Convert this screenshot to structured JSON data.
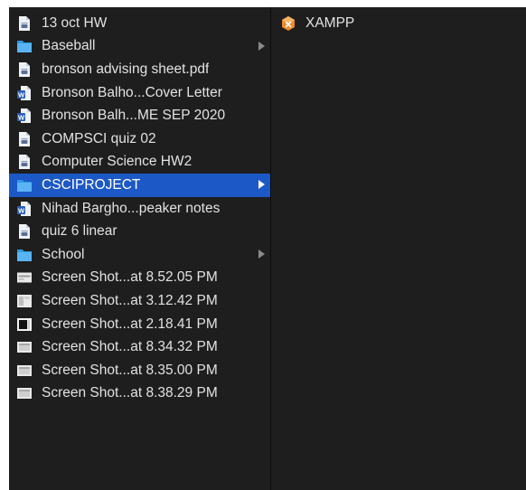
{
  "left_column": {
    "items": [
      {
        "label": "13 oct HW",
        "icon": "document-icon",
        "chevron": false,
        "selected": false
      },
      {
        "label": "Baseball",
        "icon": "folder-icon",
        "chevron": true,
        "selected": false
      },
      {
        "label": "bronson advising sheet.pdf",
        "icon": "document-icon",
        "chevron": false,
        "selected": false
      },
      {
        "label": "Bronson Balho...Cover Letter",
        "icon": "word-document-icon",
        "chevron": false,
        "selected": false
      },
      {
        "label": "Bronson Balh...ME SEP 2020",
        "icon": "word-document-icon",
        "chevron": false,
        "selected": false
      },
      {
        "label": "COMPSCI quiz 02",
        "icon": "document-icon",
        "chevron": false,
        "selected": false
      },
      {
        "label": "Computer Science HW2",
        "icon": "document-icon",
        "chevron": false,
        "selected": false
      },
      {
        "label": "CSCIPROJECT",
        "icon": "folder-icon",
        "chevron": true,
        "selected": true
      },
      {
        "label": "Nihad Bargho...peaker notes",
        "icon": "word-document-icon",
        "chevron": false,
        "selected": false
      },
      {
        "label": "quiz 6 linear",
        "icon": "document-icon",
        "chevron": false,
        "selected": false
      },
      {
        "label": "School",
        "icon": "folder-icon",
        "chevron": true,
        "selected": false
      },
      {
        "label": "Screen Shot...at 8.52.05 PM",
        "icon": "screenshot-icon",
        "chevron": false,
        "selected": false
      },
      {
        "label": "Screen Shot...at 3.12.42 PM",
        "icon": "screenshot-icon",
        "chevron": false,
        "selected": false
      },
      {
        "label": "Screen Shot...at 2.18.41 PM",
        "icon": "screenshot-icon",
        "chevron": false,
        "selected": false
      },
      {
        "label": "Screen Shot...at 8.34.32 PM",
        "icon": "screenshot-icon",
        "chevron": false,
        "selected": false
      },
      {
        "label": "Screen Shot...at 8.35.00 PM",
        "icon": "screenshot-icon",
        "chevron": false,
        "selected": false
      },
      {
        "label": "Screen Shot...at 8.38.29 PM",
        "icon": "screenshot-icon",
        "chevron": false,
        "selected": false
      }
    ]
  },
  "right_column": {
    "items": [
      {
        "label": "XAMPP",
        "icon": "xampp-app-icon"
      }
    ]
  },
  "colors": {
    "background": "#1e1e1e",
    "selection": "#1c58c6",
    "folder": "#2f9ae6",
    "text": "#e2e2e2"
  }
}
